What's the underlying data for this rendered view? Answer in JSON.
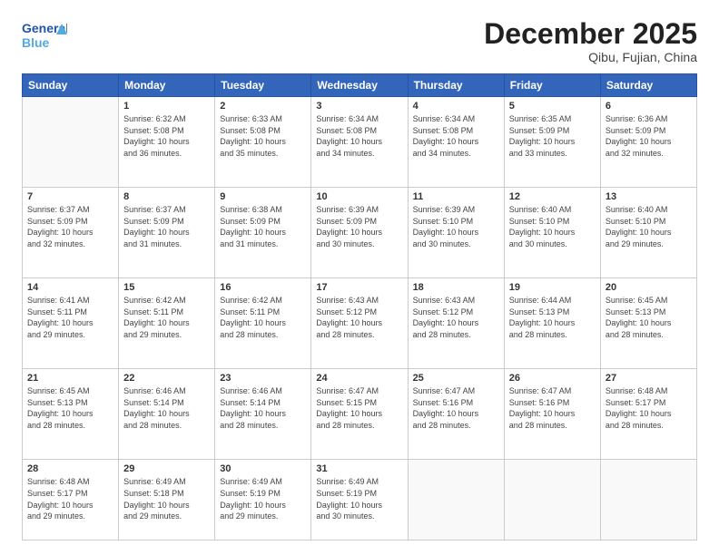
{
  "logo": {
    "line1": "General",
    "line2": "Blue"
  },
  "header": {
    "month": "December 2025",
    "location": "Qibu, Fujian, China"
  },
  "weekdays": [
    "Sunday",
    "Monday",
    "Tuesday",
    "Wednesday",
    "Thursday",
    "Friday",
    "Saturday"
  ],
  "weeks": [
    [
      {
        "day": "",
        "info": ""
      },
      {
        "day": "1",
        "info": "Sunrise: 6:32 AM\nSunset: 5:08 PM\nDaylight: 10 hours\nand 36 minutes."
      },
      {
        "day": "2",
        "info": "Sunrise: 6:33 AM\nSunset: 5:08 PM\nDaylight: 10 hours\nand 35 minutes."
      },
      {
        "day": "3",
        "info": "Sunrise: 6:34 AM\nSunset: 5:08 PM\nDaylight: 10 hours\nand 34 minutes."
      },
      {
        "day": "4",
        "info": "Sunrise: 6:34 AM\nSunset: 5:08 PM\nDaylight: 10 hours\nand 34 minutes."
      },
      {
        "day": "5",
        "info": "Sunrise: 6:35 AM\nSunset: 5:09 PM\nDaylight: 10 hours\nand 33 minutes."
      },
      {
        "day": "6",
        "info": "Sunrise: 6:36 AM\nSunset: 5:09 PM\nDaylight: 10 hours\nand 32 minutes."
      }
    ],
    [
      {
        "day": "7",
        "info": "Sunrise: 6:37 AM\nSunset: 5:09 PM\nDaylight: 10 hours\nand 32 minutes."
      },
      {
        "day": "8",
        "info": "Sunrise: 6:37 AM\nSunset: 5:09 PM\nDaylight: 10 hours\nand 31 minutes."
      },
      {
        "day": "9",
        "info": "Sunrise: 6:38 AM\nSunset: 5:09 PM\nDaylight: 10 hours\nand 31 minutes."
      },
      {
        "day": "10",
        "info": "Sunrise: 6:39 AM\nSunset: 5:09 PM\nDaylight: 10 hours\nand 30 minutes."
      },
      {
        "day": "11",
        "info": "Sunrise: 6:39 AM\nSunset: 5:10 PM\nDaylight: 10 hours\nand 30 minutes."
      },
      {
        "day": "12",
        "info": "Sunrise: 6:40 AM\nSunset: 5:10 PM\nDaylight: 10 hours\nand 30 minutes."
      },
      {
        "day": "13",
        "info": "Sunrise: 6:40 AM\nSunset: 5:10 PM\nDaylight: 10 hours\nand 29 minutes."
      }
    ],
    [
      {
        "day": "14",
        "info": "Sunrise: 6:41 AM\nSunset: 5:11 PM\nDaylight: 10 hours\nand 29 minutes."
      },
      {
        "day": "15",
        "info": "Sunrise: 6:42 AM\nSunset: 5:11 PM\nDaylight: 10 hours\nand 29 minutes."
      },
      {
        "day": "16",
        "info": "Sunrise: 6:42 AM\nSunset: 5:11 PM\nDaylight: 10 hours\nand 28 minutes."
      },
      {
        "day": "17",
        "info": "Sunrise: 6:43 AM\nSunset: 5:12 PM\nDaylight: 10 hours\nand 28 minutes."
      },
      {
        "day": "18",
        "info": "Sunrise: 6:43 AM\nSunset: 5:12 PM\nDaylight: 10 hours\nand 28 minutes."
      },
      {
        "day": "19",
        "info": "Sunrise: 6:44 AM\nSunset: 5:13 PM\nDaylight: 10 hours\nand 28 minutes."
      },
      {
        "day": "20",
        "info": "Sunrise: 6:45 AM\nSunset: 5:13 PM\nDaylight: 10 hours\nand 28 minutes."
      }
    ],
    [
      {
        "day": "21",
        "info": "Sunrise: 6:45 AM\nSunset: 5:13 PM\nDaylight: 10 hours\nand 28 minutes."
      },
      {
        "day": "22",
        "info": "Sunrise: 6:46 AM\nSunset: 5:14 PM\nDaylight: 10 hours\nand 28 minutes."
      },
      {
        "day": "23",
        "info": "Sunrise: 6:46 AM\nSunset: 5:14 PM\nDaylight: 10 hours\nand 28 minutes."
      },
      {
        "day": "24",
        "info": "Sunrise: 6:47 AM\nSunset: 5:15 PM\nDaylight: 10 hours\nand 28 minutes."
      },
      {
        "day": "25",
        "info": "Sunrise: 6:47 AM\nSunset: 5:16 PM\nDaylight: 10 hours\nand 28 minutes."
      },
      {
        "day": "26",
        "info": "Sunrise: 6:47 AM\nSunset: 5:16 PM\nDaylight: 10 hours\nand 28 minutes."
      },
      {
        "day": "27",
        "info": "Sunrise: 6:48 AM\nSunset: 5:17 PM\nDaylight: 10 hours\nand 28 minutes."
      }
    ],
    [
      {
        "day": "28",
        "info": "Sunrise: 6:48 AM\nSunset: 5:17 PM\nDaylight: 10 hours\nand 29 minutes."
      },
      {
        "day": "29",
        "info": "Sunrise: 6:49 AM\nSunset: 5:18 PM\nDaylight: 10 hours\nand 29 minutes."
      },
      {
        "day": "30",
        "info": "Sunrise: 6:49 AM\nSunset: 5:19 PM\nDaylight: 10 hours\nand 29 minutes."
      },
      {
        "day": "31",
        "info": "Sunrise: 6:49 AM\nSunset: 5:19 PM\nDaylight: 10 hours\nand 30 minutes."
      },
      {
        "day": "",
        "info": ""
      },
      {
        "day": "",
        "info": ""
      },
      {
        "day": "",
        "info": ""
      }
    ]
  ]
}
